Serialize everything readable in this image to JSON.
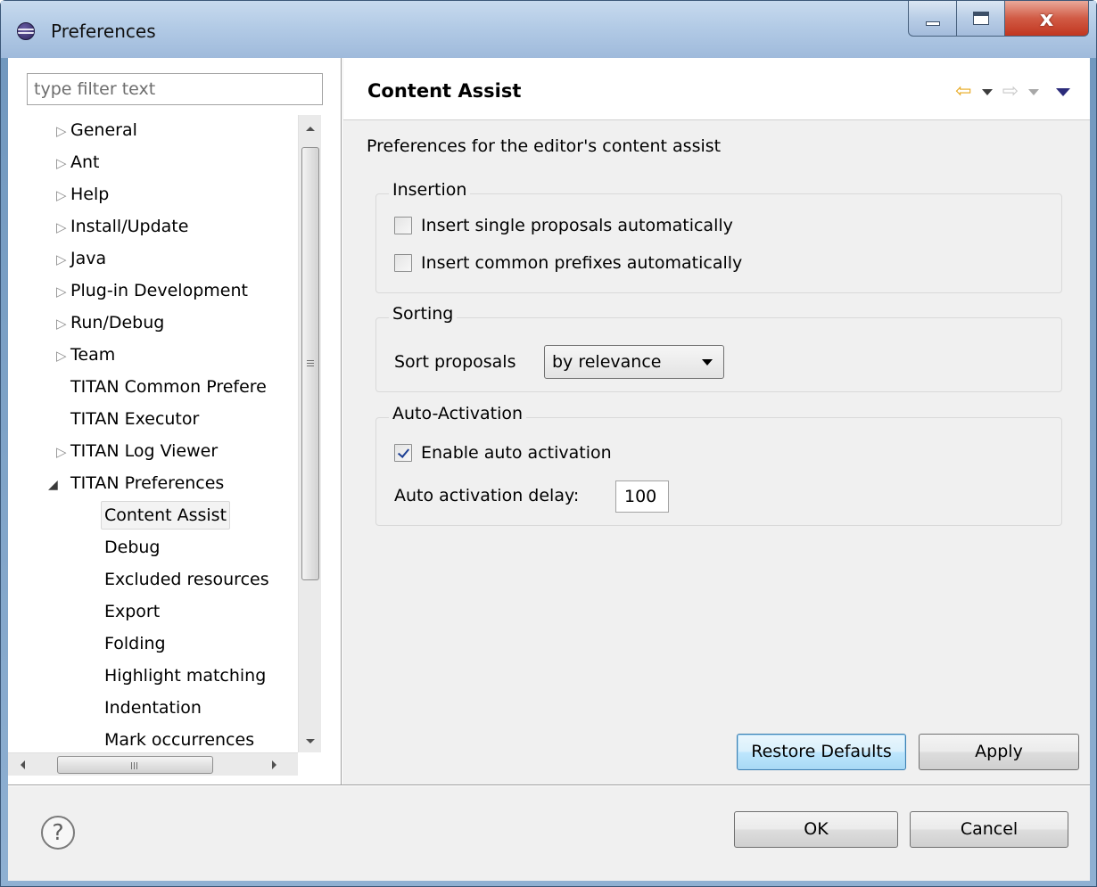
{
  "window": {
    "title": "Preferences"
  },
  "filter": {
    "placeholder": "type filter text"
  },
  "tree": [
    {
      "label": "General",
      "level": 0,
      "state": "collapsed"
    },
    {
      "label": "Ant",
      "level": 0,
      "state": "collapsed"
    },
    {
      "label": "Help",
      "level": 0,
      "state": "collapsed"
    },
    {
      "label": "Install/Update",
      "level": 0,
      "state": "collapsed"
    },
    {
      "label": "Java",
      "level": 0,
      "state": "collapsed"
    },
    {
      "label": "Plug-in Development",
      "level": 0,
      "state": "collapsed"
    },
    {
      "label": "Run/Debug",
      "level": 0,
      "state": "collapsed"
    },
    {
      "label": "Team",
      "level": 0,
      "state": "collapsed"
    },
    {
      "label": "TITAN Common Prefere",
      "level": 0,
      "state": "leaf"
    },
    {
      "label": "TITAN Executor",
      "level": 0,
      "state": "leaf"
    },
    {
      "label": "TITAN Log Viewer",
      "level": 0,
      "state": "collapsed"
    },
    {
      "label": "TITAN Preferences",
      "level": 0,
      "state": "expanded"
    },
    {
      "label": "Content Assist",
      "level": 1,
      "state": "leaf",
      "selected": true
    },
    {
      "label": "Debug",
      "level": 1,
      "state": "leaf"
    },
    {
      "label": "Excluded resources",
      "level": 1,
      "state": "leaf"
    },
    {
      "label": "Export",
      "level": 1,
      "state": "leaf"
    },
    {
      "label": "Folding",
      "level": 1,
      "state": "leaf"
    },
    {
      "label": "Highlight matching",
      "level": 1,
      "state": "leaf"
    },
    {
      "label": "Indentation",
      "level": 1,
      "state": "leaf"
    },
    {
      "label": "Mark occurrences",
      "level": 1,
      "state": "leaf"
    }
  ],
  "scroll": {
    "hthumb_glyph": "III"
  },
  "page": {
    "title": "Content Assist",
    "description": "Preferences for the editor's content assist",
    "insertion": {
      "label": "Insertion",
      "single": {
        "label": "Insert single proposals automatically",
        "checked": false
      },
      "prefixes": {
        "label": "Insert common prefixes automatically",
        "checked": false
      }
    },
    "sorting": {
      "label": "Sorting",
      "sort_label": "Sort proposals",
      "sort_value": "by relevance"
    },
    "auto": {
      "label": "Auto-Activation",
      "enable": {
        "label": "Enable auto activation",
        "checked": true
      },
      "delay_label": "Auto activation delay:",
      "delay_value": "100"
    },
    "restore_label": "Restore Defaults",
    "apply_label": "Apply"
  },
  "dialog": {
    "help_glyph": "?",
    "ok_label": "OK",
    "cancel_label": "Cancel"
  },
  "colors": {
    "nav_back": "#e7a81e",
    "nav_forward_disabled": "#c9c9c9",
    "selection_bg": "#f3f3f3"
  }
}
